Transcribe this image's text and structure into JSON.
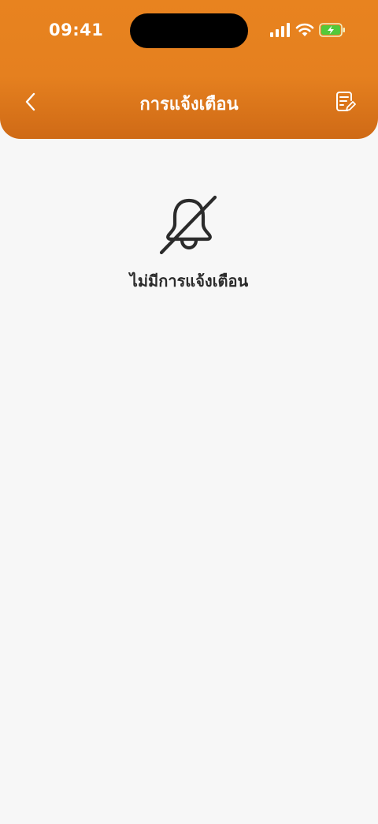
{
  "status_bar": {
    "time": "09:41"
  },
  "header": {
    "title": "การแจ้งเตือน",
    "back_icon": "chevron-left-icon",
    "edit_icon": "note-edit-icon"
  },
  "empty_state": {
    "icon": "bell-off-icon",
    "message": "ไม่มีการแจ้งเตือน"
  },
  "colors": {
    "header_top": "#e8831f",
    "header_bottom": "#cf6a16",
    "background": "#f7f7f7",
    "text_dark": "#2b2b2b",
    "battery_fill": "#52c93a"
  }
}
